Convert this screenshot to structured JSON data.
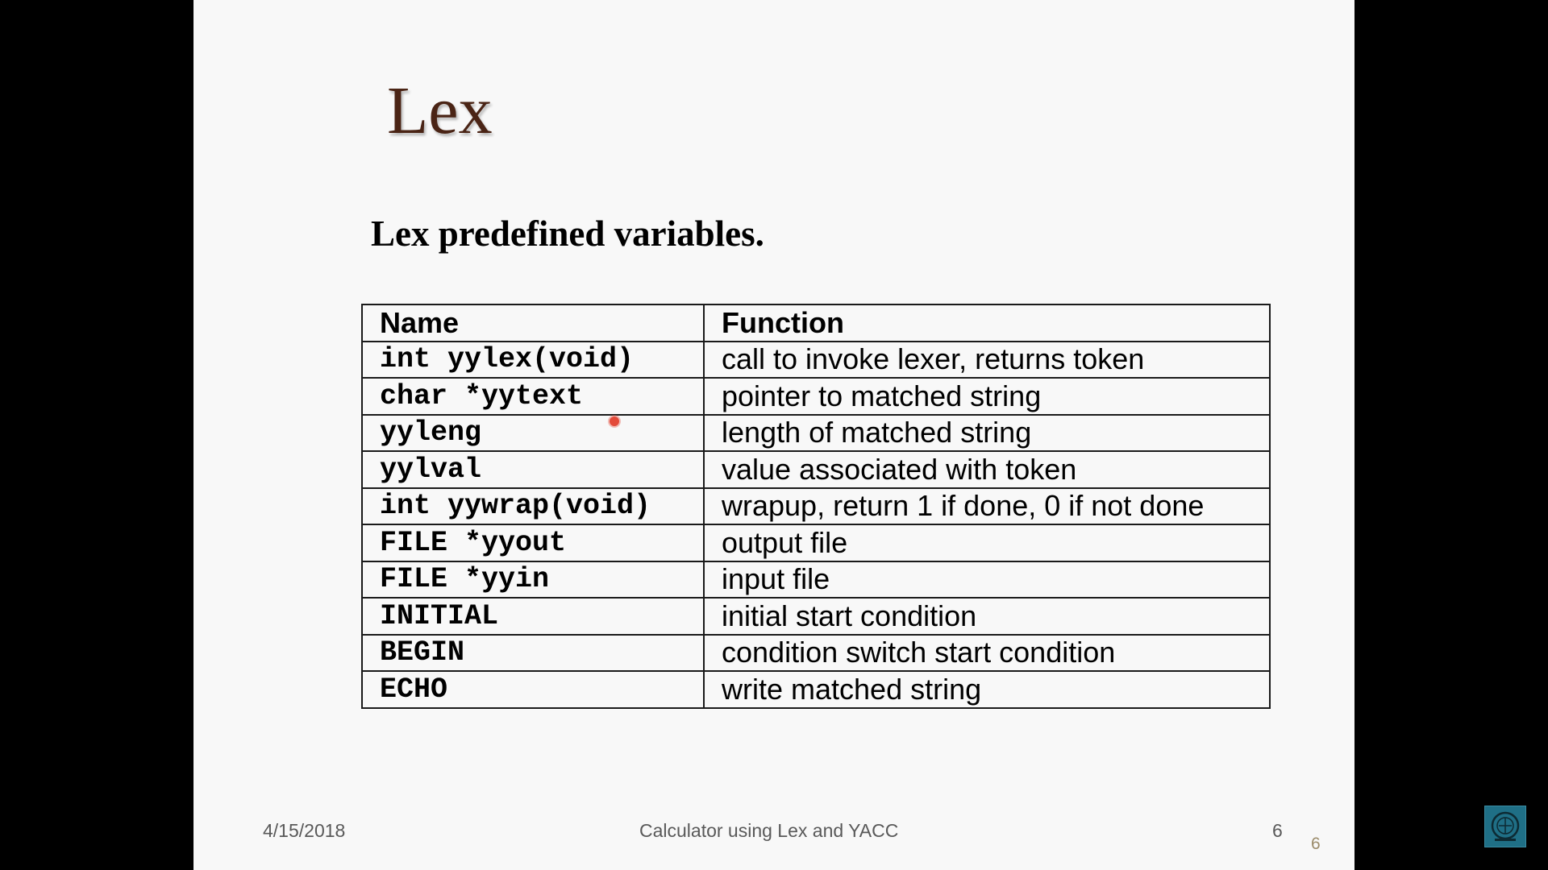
{
  "slide": {
    "title": "Lex",
    "subtitle": "Lex predefined variables."
  },
  "table": {
    "headers": {
      "name": "Name",
      "function": "Function"
    },
    "rows": [
      {
        "name": "int yylex(void)",
        "function": "call to invoke lexer, returns token"
      },
      {
        "name": "char *yytext",
        "function": "pointer to matched string"
      },
      {
        "name": "yyleng",
        "function": "length of matched string"
      },
      {
        "name": "yylval",
        "function": "value associated with token"
      },
      {
        "name": "int yywrap(void)",
        "function": "wrapup, return 1 if done, 0 if not done"
      },
      {
        "name": "FILE *yyout",
        "function": "output file"
      },
      {
        "name": "FILE *yyin",
        "function": "input file"
      },
      {
        "name": "INITIAL",
        "function": "initial start condition"
      },
      {
        "name": "BEGIN",
        "function": "condition switch start condition"
      },
      {
        "name": "ECHO",
        "function": "write matched string"
      }
    ]
  },
  "footer": {
    "date": "4/15/2018",
    "center": "Calculator using Lex and YACC",
    "page": "6",
    "corner_number": "6"
  },
  "colors": {
    "title": "#4a2415",
    "slide_background": "#f8f8f8",
    "letterbox": "#000000",
    "footer_text": "#595959",
    "corner_number": "#9b8b6a",
    "cursor": "#e34a3a",
    "logo": "#1f6f86"
  },
  "icons": {
    "cursor": "cursor-dot-icon",
    "logo": "logo-badge-icon"
  }
}
